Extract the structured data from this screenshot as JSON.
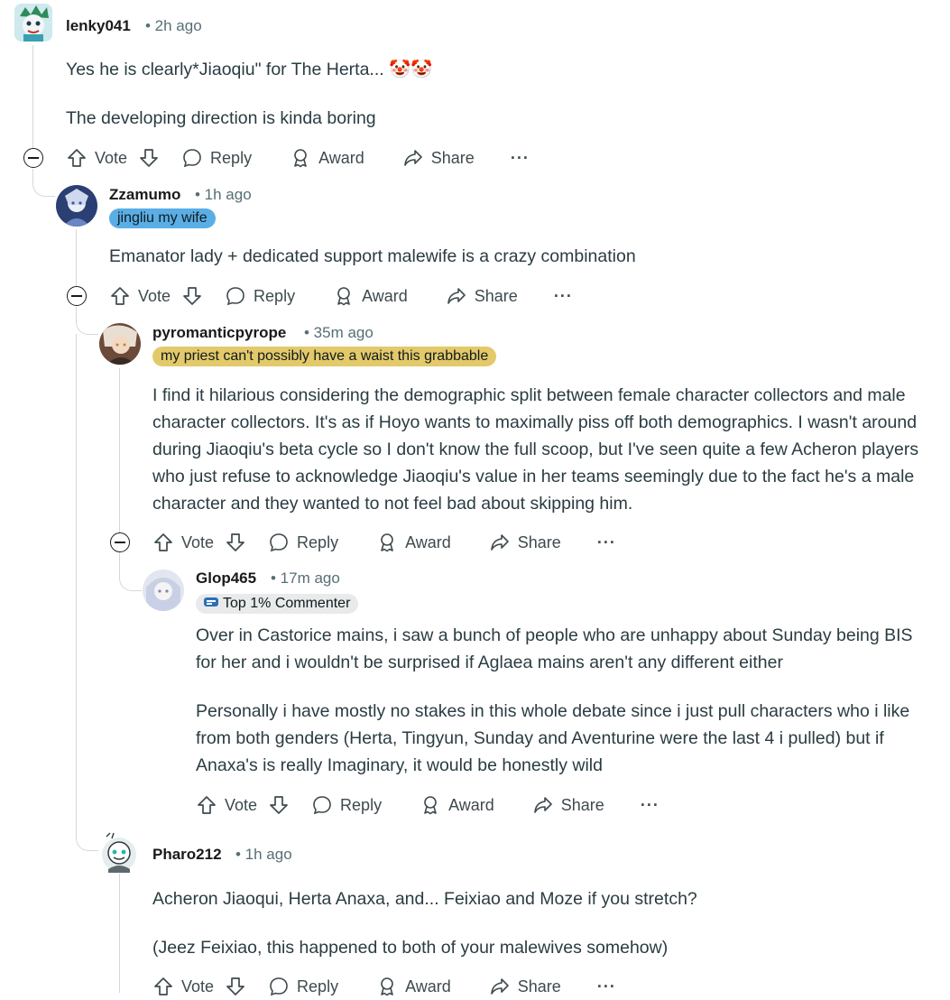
{
  "comments": [
    {
      "username": "lenky041",
      "time": "• 2h ago",
      "body": [
        "Yes he is clearly*Jiaoqiu\" for The Herta... 🤡🤡",
        "The developing direction is kinda boring"
      ]
    },
    {
      "username": "Zzamumo",
      "time": "• 1h ago",
      "flair": "jingliu my wife",
      "body": [
        "Emanator lady + dedicated support malewife is a crazy combination"
      ]
    },
    {
      "username": "pyromanticpyrope",
      "time": "• 35m ago",
      "flair": "my priest can't possibly have a waist this grabbable",
      "body": [
        "I find it hilarious considering the demographic split between female character collectors and male character collectors. It's as if Hoyo wants to maximally piss off both demographics. I wasn't around during Jiaoqiu's beta cycle so I don't know the full scoop, but I've seen quite a few Acheron players who just refuse to acknowledge Jiaoqiu's value in her teams seemingly due to the fact he's a male character and they wanted to not feel bad about skipping him."
      ]
    },
    {
      "username": "Glop465",
      "time": "• 17m ago",
      "flair": "Top 1% Commenter",
      "body": [
        "Over in Castorice mains, i saw a bunch of people who are unhappy about Sunday being BIS for her and i wouldn't be surprised if Aglaea mains aren't any different either",
        "Personally i have mostly no stakes in this whole debate since i just pull characters who i like from both genders (Herta, Tingyun, Sunday and Aventurine were the last 4 i pulled) but if Anaxa's is really Imaginary, it would be honestly wild"
      ]
    },
    {
      "username": "Pharo212",
      "time": "• 1h ago",
      "body": [
        "Acheron Jiaoqui, Herta Anaxa, and... Feixiao and Moze if you stretch?",
        "(Jeez Feixiao, this happened to both of your malewives somehow)"
      ]
    }
  ],
  "actions": {
    "vote": "Vote",
    "reply": "Reply",
    "award": "Award",
    "share": "Share",
    "more": "···"
  },
  "colors": {
    "flair_blue": "#5aaee6",
    "flair_gold": "#e3c96a",
    "flair_gray": "#e8eaec"
  }
}
